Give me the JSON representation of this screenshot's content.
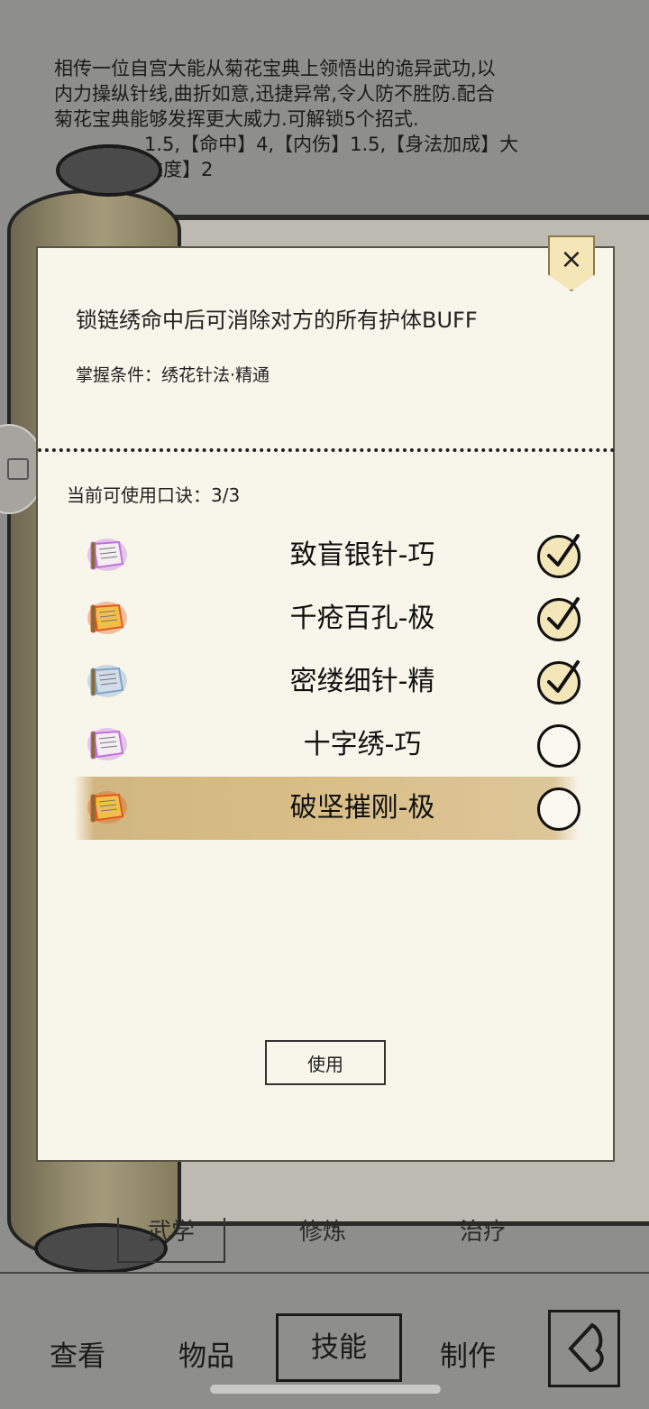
{
  "background": {
    "description_lines": [
      "相传一位自宫大能从菊花宝典上领悟出的诡异武功,以",
      "内力操纵针线,曲折如意,迅捷异常,令人防不胜防.配合",
      "菊花宝典能够发挥更大威力.可解锁5个招式.",
      "1.5,【命中】4,【内伤】1.5,【身法加成】大",
      "难度】2"
    ],
    "tabs": [
      "武学",
      "修炼",
      "治疗"
    ],
    "nav": {
      "view": "查看",
      "items": "物品",
      "skills": "技能",
      "craft": "制作"
    }
  },
  "modal": {
    "description": "锁链绣命中后可消除对方的所有护体BUFF",
    "condition": "掌握条件：绣花针法·精通",
    "available_label": "当前可使用口诀：3/3",
    "use_button": "使用",
    "close_icon": "×",
    "skills": [
      {
        "name": "致盲银针-巧",
        "tier": "purple",
        "checked": true,
        "selected": false
      },
      {
        "name": "千疮百孔-极",
        "tier": "orange",
        "checked": true,
        "selected": false
      },
      {
        "name": "密缕细针-精",
        "tier": "blue",
        "checked": true,
        "selected": false
      },
      {
        "name": "十字绣-巧",
        "tier": "purple",
        "checked": false,
        "selected": false
      },
      {
        "name": "破坚摧刚-极",
        "tier": "orange",
        "checked": false,
        "selected": true
      }
    ]
  },
  "colors": {
    "purple_glow": "#c070e0",
    "orange_glow": "#e05a1a",
    "blue_glow": "#7ea4c8",
    "selected_row": "#d6b87c"
  }
}
